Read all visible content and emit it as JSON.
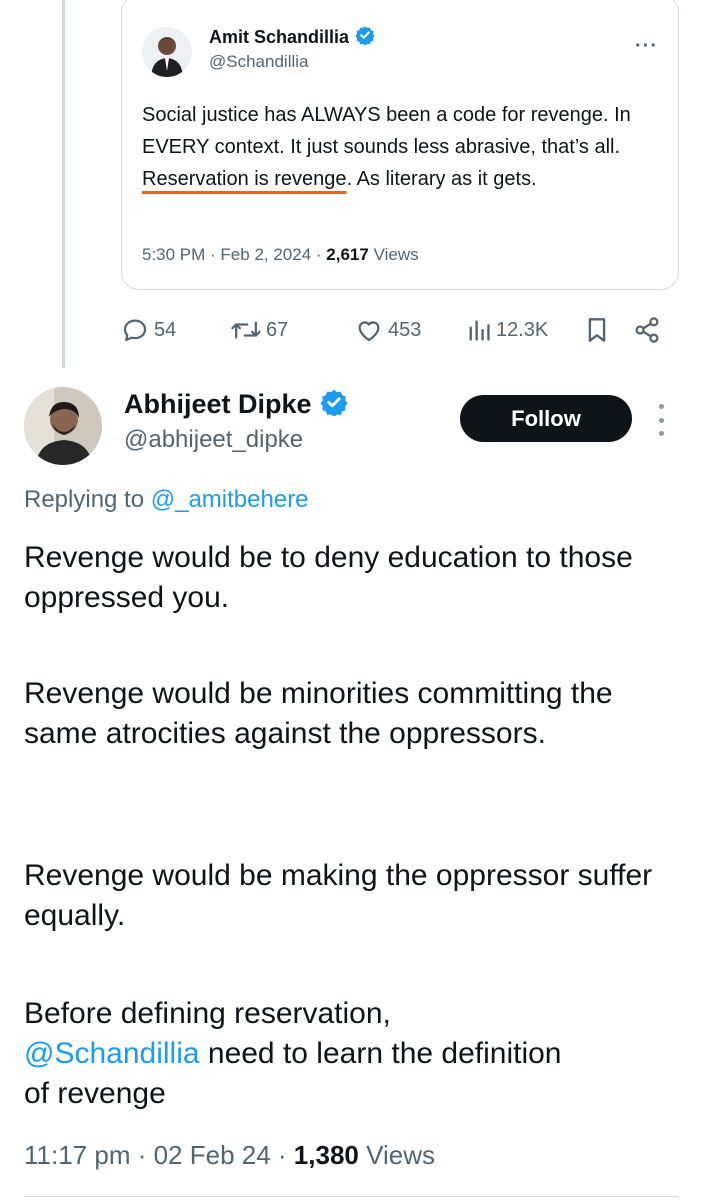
{
  "quoted_tweet": {
    "author_name": "Amit Schandillia",
    "author_handle": "@Schandillia",
    "text_before": "Social justice has ALWAYS been a code for revenge. In EVERY context. It just sounds less abrasive, that’s all. ",
    "text_underlined": "Reservation is revenge",
    "text_after": ". As literary as it gets.",
    "time": "5:30 PM",
    "date": "Feb 2, 2024",
    "views_count": "2,617",
    "views_label": "Views",
    "more_label": "···"
  },
  "actions": {
    "replies": "54",
    "retweets": "67",
    "likes": "453",
    "views": "12.3K"
  },
  "reply_tweet": {
    "author_name": "Abhijeet Dipke",
    "author_handle": "@abhijeet_dipke",
    "follow_label": "Follow",
    "replying_prefix": "Replying to ",
    "replying_to": "@_amitbehere",
    "paragraphs": [
      "Revenge would be to deny education to those oppressed you.",
      "Revenge would be minorities committing the same atrocities against the oppressors.",
      "Revenge would be making the oppressor suffer equally."
    ],
    "last_paragraph_before": "Before defining reservation,",
    "last_paragraph_mention": "@Schandillia",
    "last_paragraph_after": " need to learn the definition of revenge",
    "time": "11:17 pm",
    "date": "02 Feb 24",
    "views_count": "1,380",
    "views_label": "Views"
  },
  "colors": {
    "accent": "#1d9bf0",
    "underline": "#e8632a",
    "secondary_text": "#536471",
    "button_bg": "#0f1419"
  }
}
